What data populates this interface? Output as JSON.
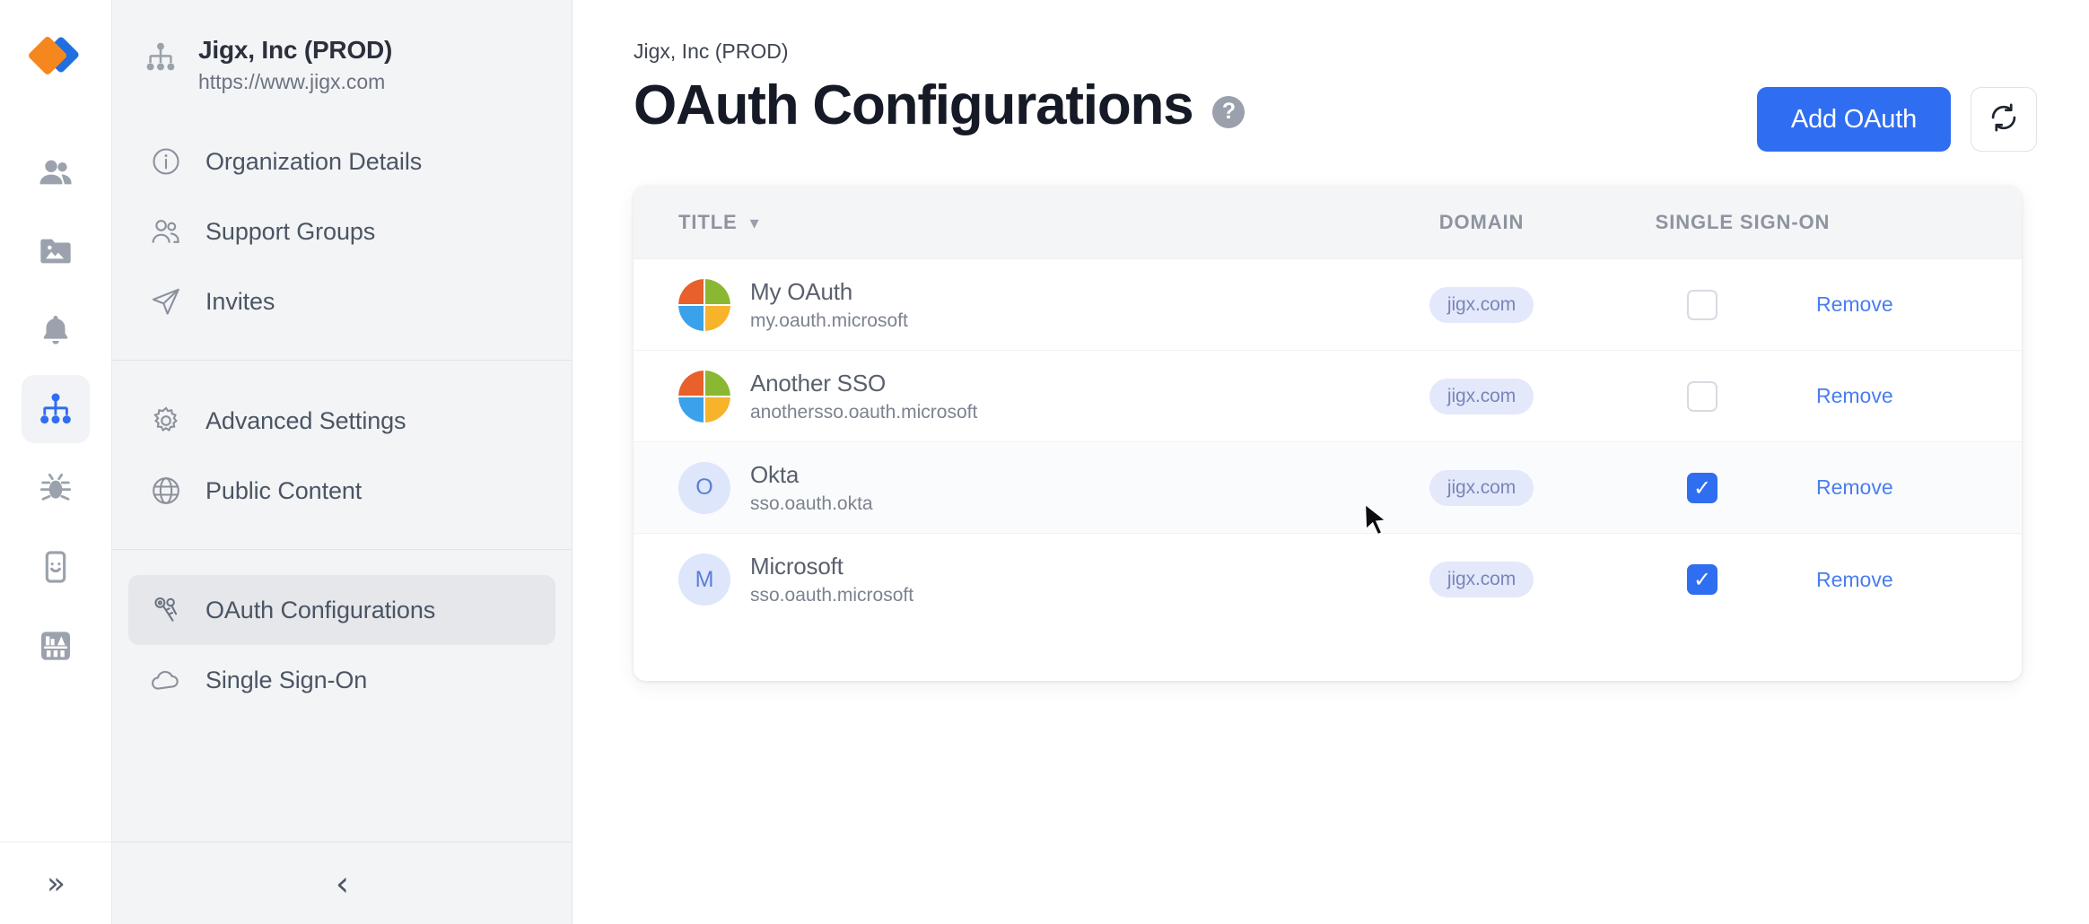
{
  "brand": {
    "logo_name": "jigx-logo",
    "accent": "#2f6ef0"
  },
  "rail": {
    "items": [
      {
        "name": "users-icon",
        "label": "Users",
        "active": false
      },
      {
        "name": "media-folder-icon",
        "label": "Media",
        "active": false
      },
      {
        "name": "bell-icon",
        "label": "Notifications",
        "active": false
      },
      {
        "name": "org-chart-icon",
        "label": "Organization",
        "active": true
      },
      {
        "name": "bug-icon",
        "label": "Debug",
        "active": false
      },
      {
        "name": "mobile-smiley-icon",
        "label": "App Preview",
        "active": false
      },
      {
        "name": "library-icon",
        "label": "Library",
        "active": false
      }
    ],
    "expand_label": "»"
  },
  "sidebar": {
    "org_name": "Jigx, Inc (PROD)",
    "org_url": "https://www.jigx.com",
    "org_icon": "org-chart-icon",
    "group_one": [
      {
        "label": "Organization Details",
        "icon": "info-circle-icon",
        "active": false
      },
      {
        "label": "Support Groups",
        "icon": "people-outline-icon",
        "active": false
      },
      {
        "label": "Invites",
        "icon": "send-plane-icon",
        "active": false
      }
    ],
    "group_two": [
      {
        "label": "Advanced Settings",
        "icon": "gear-icon",
        "active": false
      },
      {
        "label": "Public Content",
        "icon": "globe-icon",
        "active": false
      }
    ],
    "group_three": [
      {
        "label": "OAuth Configurations",
        "icon": "keys-icon",
        "active": true
      },
      {
        "label": "Single Sign-On",
        "icon": "cloud-icon",
        "active": false
      }
    ],
    "collapse_label": "‹"
  },
  "header": {
    "breadcrumb": "Jigx, Inc (PROD)",
    "title": "OAuth Configurations",
    "help_label": "?",
    "add_button": "Add OAuth",
    "refresh_icon": "refresh-icon"
  },
  "table": {
    "columns": [
      {
        "key": "title",
        "label": "TITLE",
        "sortable": true,
        "sort_chevron": "▾"
      },
      {
        "key": "domain",
        "label": "DOMAIN",
        "sortable": false
      },
      {
        "key": "sso",
        "label": "SINGLE SIGN-ON",
        "sortable": false
      }
    ],
    "remove_label": "Remove",
    "rows": [
      {
        "title": "My OAuth",
        "subtitle": "my.oauth.microsoft",
        "avatar_type": "microsoft",
        "avatar_letter": "",
        "domain": "jigx.com",
        "sso_enabled": false,
        "hovered": false
      },
      {
        "title": "Another SSO",
        "subtitle": "anothersso.oauth.microsoft",
        "avatar_type": "microsoft",
        "avatar_letter": "",
        "domain": "jigx.com",
        "sso_enabled": false,
        "hovered": false
      },
      {
        "title": "Okta",
        "subtitle": "sso.oauth.okta",
        "avatar_type": "letter",
        "avatar_letter": "O",
        "domain": "jigx.com",
        "sso_enabled": true,
        "hovered": true
      },
      {
        "title": "Microsoft",
        "subtitle": "sso.oauth.microsoft",
        "avatar_type": "letter",
        "avatar_letter": "M",
        "domain": "jigx.com",
        "sso_enabled": true,
        "hovered": false
      }
    ]
  }
}
